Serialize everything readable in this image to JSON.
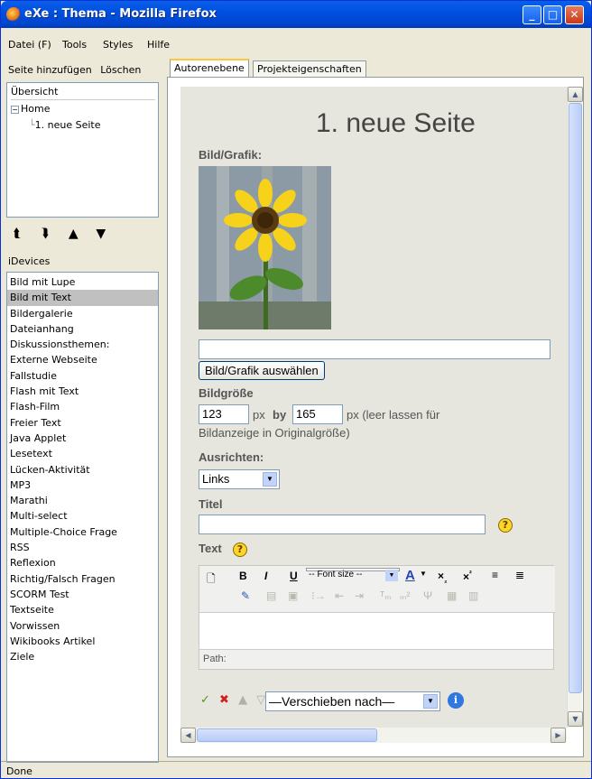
{
  "window": {
    "title": "eXe : Thema - Mozilla Firefox"
  },
  "menu": {
    "datei": "Datei (F)",
    "tools": "Tools",
    "styles": "Styles",
    "hilfe": "Hilfe"
  },
  "outline": {
    "add_page": "Seite hinzufügen",
    "delete": "Löschen",
    "header": "Übersicht",
    "home": "Home",
    "child": "1. neue Seite"
  },
  "idevices": {
    "label": "iDevices",
    "items": [
      "Bild mit Lupe",
      "Bild mit Text",
      "Bildergalerie",
      "Dateianhang",
      "Diskussionsthemen:",
      "Externe Webseite",
      "Fallstudie",
      "Flash mit Text",
      "Flash-Film",
      "Freier Text",
      "Java Applet",
      "Lesetext",
      "Lücken-Aktivität",
      "MP3",
      "Marathi",
      "Multi-select",
      "Multiple-Choice Frage",
      "RSS",
      "Reflexion",
      "Richtig/Falsch Fragen",
      "SCORM Test",
      "Textseite",
      "Vorwissen",
      "Wikibooks Artikel",
      "Ziele"
    ],
    "selected": "Bild mit Text"
  },
  "tabs": {
    "author": "Autorenebene",
    "project": "Projekteigenschaften"
  },
  "editor": {
    "page_title": "1. neue Seite",
    "image_label": "Bild/Grafik:",
    "select_image": "Bild/Grafik auswählen",
    "size_label": "Bildgröße",
    "width": "123",
    "height": "165",
    "px1": "px",
    "by": "by",
    "px2": "px (leer lassen für",
    "size_hint": "Bildanzeige in Originalgröße)",
    "align_label": "Ausrichten:",
    "align_value": "Links",
    "title_label": "Titel",
    "text_label": "Text",
    "font_size": "-- Font size --",
    "path": "Path:",
    "move_to": "—Verschieben nach—"
  },
  "status": {
    "text": "Done"
  }
}
